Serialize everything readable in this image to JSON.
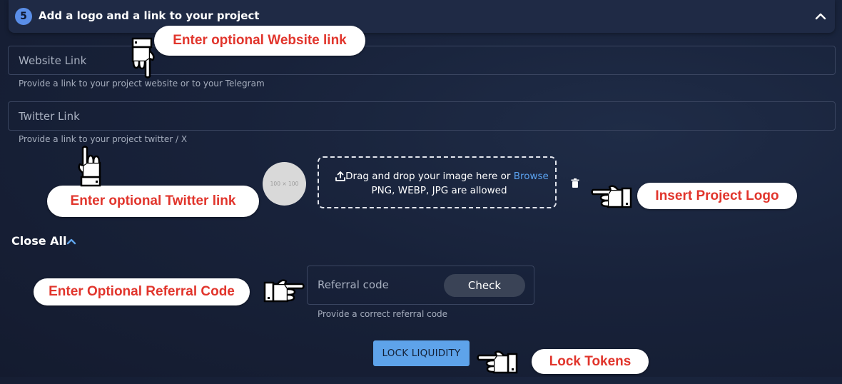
{
  "section": {
    "step_number": "5",
    "title": "Add a logo and a link to your project",
    "collapse_icon": "chevron-up-icon"
  },
  "website": {
    "placeholder": "Website Link",
    "helper": "Provide a link to your project website or to your Telegram"
  },
  "twitter": {
    "placeholder": "Twitter Link",
    "helper": "Provide a link to your project twitter / X"
  },
  "logo": {
    "placeholder_size": "100 × 100",
    "drop_text": "Drag and drop your image here or",
    "browse_label": "Browse",
    "formats": "PNG, WEBP, JPG are allowed",
    "upload_icon": "upload-icon",
    "delete_icon": "trash-icon"
  },
  "close_all": {
    "label": "Close All",
    "icon": "chevron-up-icon"
  },
  "referral": {
    "placeholder": "Referral code",
    "check_label": "Check",
    "helper": "Provide a correct referral code"
  },
  "lock_button": {
    "label": "LOCK LIQUIDITY"
  },
  "callouts": {
    "website": "Enter optional Website link",
    "twitter": "Enter optional Twitter link",
    "logo": "Insert Project Logo",
    "referral": "Enter Optional Referral Code",
    "lock": "Lock Tokens"
  },
  "colors": {
    "background": "#18223a",
    "accent": "#5ea3ea",
    "callout_text": "#e1352c",
    "callout_bg": "#ffffff"
  }
}
